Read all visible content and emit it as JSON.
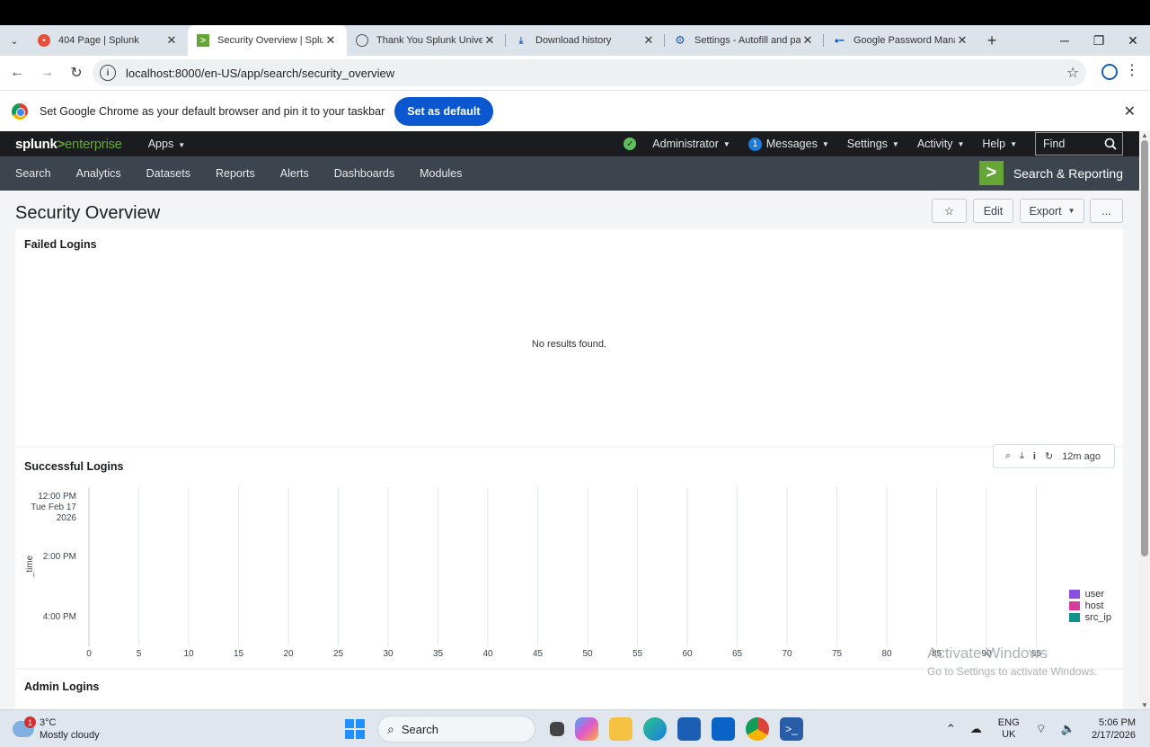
{
  "browser": {
    "tabs": [
      {
        "title": "404 Page | Splunk",
        "icon": "splunk-404-favicon",
        "active": false
      },
      {
        "title": "Security Overview | Splunk",
        "icon": "splunk-app-favicon",
        "active": true
      },
      {
        "title": "Thank You Splunk University",
        "icon": "globe-icon",
        "active": false
      },
      {
        "title": "Download history",
        "icon": "download-icon",
        "active": false
      },
      {
        "title": "Settings - Autofill and passwords",
        "icon": "gear-icon",
        "active": false
      },
      {
        "title": "Google Password Manager",
        "icon": "key-icon",
        "active": false
      }
    ],
    "url": "localhost:8000/en-US/app/search/security_overview",
    "infobar_message": "Set Google Chrome as your default browser and pin it to your taskbar",
    "infobar_button": "Set as default"
  },
  "splunk": {
    "logo_main": "splunk",
    "logo_gt": ">",
    "logo_sub": "enterprise",
    "apps_label": "Apps",
    "admin_label": "Administrator",
    "messages_count": "1",
    "messages_label": "Messages",
    "settings_label": "Settings",
    "activity_label": "Activity",
    "help_label": "Help",
    "find_placeholder": "Find",
    "app_menu": [
      "Search",
      "Analytics",
      "Datasets",
      "Reports",
      "Alerts",
      "Dashboards",
      "Modules"
    ],
    "app_name": "Search & Reporting"
  },
  "dashboard": {
    "title": "Security Overview",
    "edit_label": "Edit",
    "export_label": "Export",
    "more_label": "...",
    "panels": [
      {
        "title": "Failed Logins",
        "message": "No results found."
      },
      {
        "title": "Successful Logins",
        "refresh_ago": "12m ago"
      },
      {
        "title": "Admin Logins"
      }
    ]
  },
  "chart_data": {
    "type": "bar",
    "title": "Successful Logins",
    "ylabel": "_time",
    "y_ticks": [
      "12:00 PM|Tue Feb 17|2026",
      "2:00 PM",
      "4:00 PM"
    ],
    "x_ticks": [
      0,
      5,
      10,
      15,
      20,
      25,
      30,
      35,
      40,
      45,
      50,
      55,
      60,
      65,
      70,
      75,
      80,
      85,
      90,
      95
    ],
    "xlim": [
      0,
      100
    ],
    "series": [
      {
        "name": "user",
        "color": "#8a4fe0"
      },
      {
        "name": "host",
        "color": "#d63a9c"
      },
      {
        "name": "src_ip",
        "color": "#11918b"
      }
    ],
    "legend_position": "right",
    "grid": true
  },
  "watermark": {
    "line1": "Activate Windows",
    "line2": "Go to Settings to activate Windows."
  },
  "taskbar": {
    "weather_temp": "3°C",
    "weather_desc": "Mostly cloudy",
    "weather_badge": "1",
    "search_label": "Search",
    "lang_top": "ENG",
    "lang_bottom": "UK",
    "time": "5:06 PM",
    "date": "2/17/2026"
  }
}
